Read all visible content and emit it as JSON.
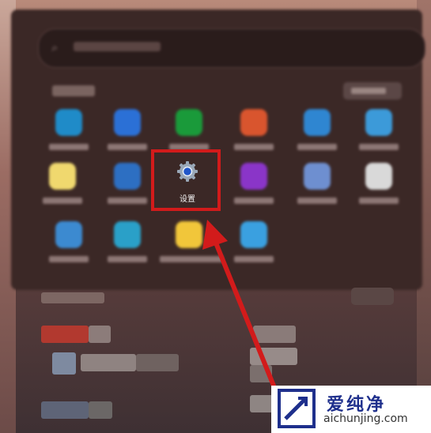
{
  "settings_label": "设置",
  "watermark": {
    "brand": "爱纯净",
    "url": "aichunjing.com"
  },
  "colors": {
    "highlight": "#d21b1b",
    "logo_blue": "#1e2f8c"
  },
  "pinned_apps": [
    {
      "icon": "edge-icon",
      "color": "#1f8bc8"
    },
    {
      "icon": "mail-icon",
      "color": "#2b70d6"
    },
    {
      "icon": "xbox-icon",
      "color": "#1a9a3a"
    },
    {
      "icon": "office-icon",
      "color": "#d9552e"
    },
    {
      "icon": "photos-icon",
      "color": "#2f86d1"
    },
    {
      "icon": "calendar-icon",
      "color": "#3c9ad9"
    },
    {
      "icon": "store-icon",
      "color": "#f0d86e"
    },
    {
      "icon": "movies-icon",
      "color": "#2d6fc2"
    },
    {
      "icon": "settings-icon",
      "color": "#2a3a5e"
    },
    {
      "icon": "clipchamp-icon",
      "color": "#8a35c8"
    },
    {
      "icon": "phone-link-icon",
      "color": "#6e8fd0"
    },
    {
      "icon": "camera-icon",
      "color": "#d9d9d9"
    },
    {
      "icon": "calculator-icon",
      "color": "#3c8ad0"
    },
    {
      "icon": "maps-icon",
      "color": "#2aa0c8"
    },
    {
      "icon": "file-explorer-icon",
      "color": "#f1c63a"
    },
    {
      "icon": "tips-icon",
      "color": "#3aa0e0"
    }
  ]
}
